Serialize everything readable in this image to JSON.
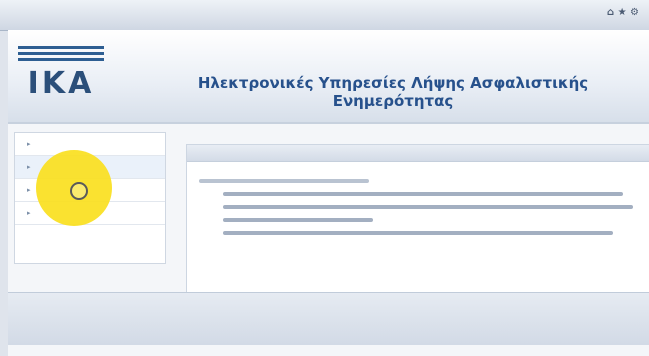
{
  "header": {
    "logo_text": "IKA",
    "heading_line1": "Ηλεκτρονικές Υπηρεσίες Λήψης Ασφαλιστικής",
    "heading_line2": "Ενημερότητας"
  },
  "sidebar": {
    "items": [
      {
        "label": ""
      },
      {
        "label": ""
      },
      {
        "label": ""
      },
      {
        "label": ""
      }
    ],
    "active_index": 1
  },
  "content": {
    "panel_title": ""
  },
  "footer": {
    "left_text": "",
    "right_text": ""
  },
  "colors": {
    "accent": "#27518c",
    "cursor_highlight": "#fae01e"
  }
}
